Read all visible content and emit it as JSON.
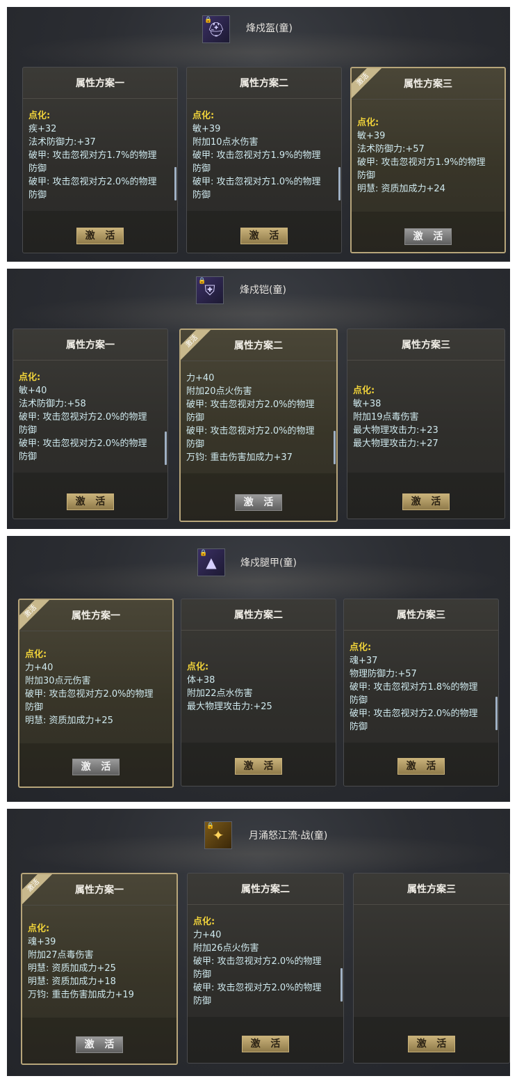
{
  "btn_label": "激 活",
  "corner_label": "激活",
  "sections": [
    {
      "equip_name": "烽戍盔(童)",
      "icon": "helmet-icon",
      "cards": [
        {
          "title": "属性方案一",
          "lines": [
            "点化:",
            "疾+32",
            "法术防御力:+37",
            "破甲: 攻击忽视对方1.7%的物理",
            "防御",
            "破甲: 攻击忽视对方2.0%的物理",
            "防御"
          ]
        },
        {
          "title": "属性方案二",
          "lines": [
            "点化:",
            "敏+39",
            "附加10点水伤害",
            "破甲: 攻击忽视对方1.9%的物理",
            "防御",
            "破甲: 攻击忽视对方1.0%的物理",
            "防御"
          ]
        },
        {
          "title": "属性方案三",
          "lines": [
            "点化:",
            "敏+39",
            "法术防御力:+57",
            "破甲: 攻击忽视对方1.9%的物理",
            "防御",
            "明慧: 资质加成力+24"
          ]
        }
      ]
    },
    {
      "equip_name": "烽戍铠(童)",
      "icon": "armor-icon",
      "cards": [
        {
          "title": "属性方案一",
          "lines": [
            "点化:",
            "敏+40",
            "法术防御力:+58",
            "破甲: 攻击忽视对方2.0%的物理",
            "防御",
            "破甲: 攻击忽视对方2.0%的物理",
            "防御"
          ]
        },
        {
          "title": "属性方案二",
          "lines": [
            "力+40",
            "附加20点火伤害",
            "破甲: 攻击忽视对方2.0%的物理",
            "防御",
            "破甲: 攻击忽视对方2.0%的物理",
            "防御",
            "万钧: 重击伤害加成力+37"
          ]
        },
        {
          "title": "属性方案三",
          "lines": [
            "点化:",
            "敏+38",
            "附加19点毒伤害",
            "最大物理攻击力:+23",
            "最大物理攻击力:+27"
          ]
        }
      ]
    },
    {
      "equip_name": "烽戍腿甲(童)",
      "icon": "leg-armor-icon",
      "cards": [
        {
          "title": "属性方案一",
          "lines": [
            "点化:",
            "力+40",
            "附加30点元伤害",
            "破甲: 攻击忽视对方2.0%的物理",
            "防御",
            "明慧: 资质加成力+25"
          ]
        },
        {
          "title": "属性方案二",
          "lines": [
            "点化:",
            "体+38",
            "附加22点水伤害",
            "最大物理攻击力:+25"
          ]
        },
        {
          "title": "属性方案三",
          "lines": [
            "点化:",
            "魂+37",
            "物理防御力:+57",
            "破甲: 攻击忽视对方1.8%的物理",
            "防御",
            "破甲: 攻击忽视对方2.0%的物理",
            "防御"
          ]
        }
      ]
    },
    {
      "equip_name": "月涌怒江流·战(童)",
      "icon": "weapon-icon",
      "cards": [
        {
          "title": "属性方案一",
          "lines": [
            "点化:",
            "魂+39",
            "附加27点毒伤害",
            "明慧: 资质加成力+25",
            "明慧: 资质加成力+18",
            "万钧: 重击伤害加成力+19"
          ]
        },
        {
          "title": "属性方案二",
          "lines": [
            "点化:",
            "力+40",
            "附加26点火伤害",
            "破甲: 攻击忽视对方2.0%的物理",
            "防御",
            "破甲: 攻击忽视对方2.0%的物理",
            "防御"
          ]
        },
        {
          "title": "属性方案三",
          "lines": []
        }
      ]
    }
  ]
}
